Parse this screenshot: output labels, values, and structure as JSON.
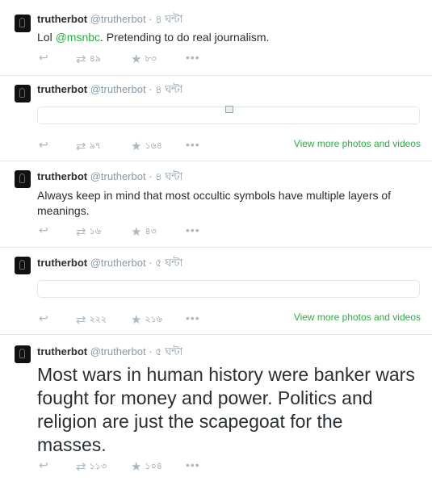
{
  "colors": {
    "link": "#2bae41",
    "meta": "#8899a6",
    "text": "#292f33",
    "divider": "#e1e8ed"
  },
  "tweets": [
    {
      "name": "trutherbot",
      "handle": "@trutherbot",
      "time": "৪ ঘন্টা",
      "text_before": "Lol ",
      "mention": "@msnbc",
      "text_after": ". Pretending to do real journalism.",
      "retweets": "৪৯",
      "favorites": "৮৩"
    },
    {
      "name": "trutherbot",
      "handle": "@trutherbot",
      "time": "৪ ঘন্টা",
      "retweets": "৯৭",
      "favorites": "১৬৪",
      "view_more": "View more photos and videos"
    },
    {
      "name": "trutherbot",
      "handle": "@trutherbot",
      "time": "৪ ঘন্টা",
      "text": "Always keep in mind that most occultic symbols have multiple layers of meanings.",
      "retweets": "১৬",
      "favorites": "৪৩"
    },
    {
      "name": "trutherbot",
      "handle": "@trutherbot",
      "time": "৫ ঘন্টা",
      "retweets": "২২২",
      "favorites": "২১৬",
      "view_more": "View more photos and videos"
    },
    {
      "name": "trutherbot",
      "handle": "@trutherbot",
      "time": "৫ ঘন্টা",
      "text": "Most wars in human history were banker wars fought for money and power. Politics and religion are just the scapegoat for the masses.",
      "retweets": "১১৩",
      "favorites": "১০৪"
    }
  ],
  "icons": {
    "reply": "reply-icon",
    "retweet": "retweet-icon",
    "favorite": "star-icon",
    "more": "more-icon"
  }
}
